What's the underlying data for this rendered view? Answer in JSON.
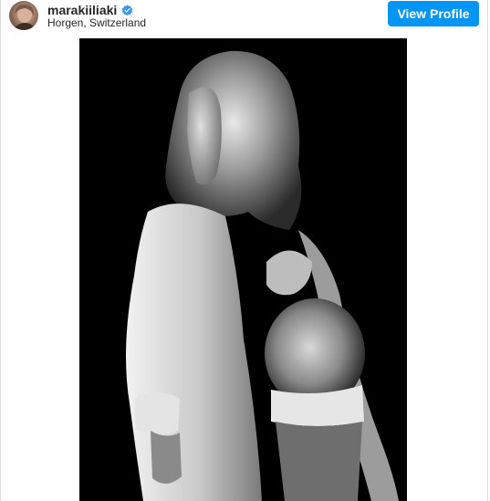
{
  "post": {
    "username": "marakiiliaki",
    "verified": true,
    "location": "Horgen, Switzerland",
    "view_profile_label": "View Profile"
  },
  "icons": {
    "verified": "verified-badge-icon"
  },
  "colors": {
    "button_blue": "#0095f6",
    "verified_blue": "#3897f0",
    "text": "#262626",
    "photo_background": "#000000"
  }
}
